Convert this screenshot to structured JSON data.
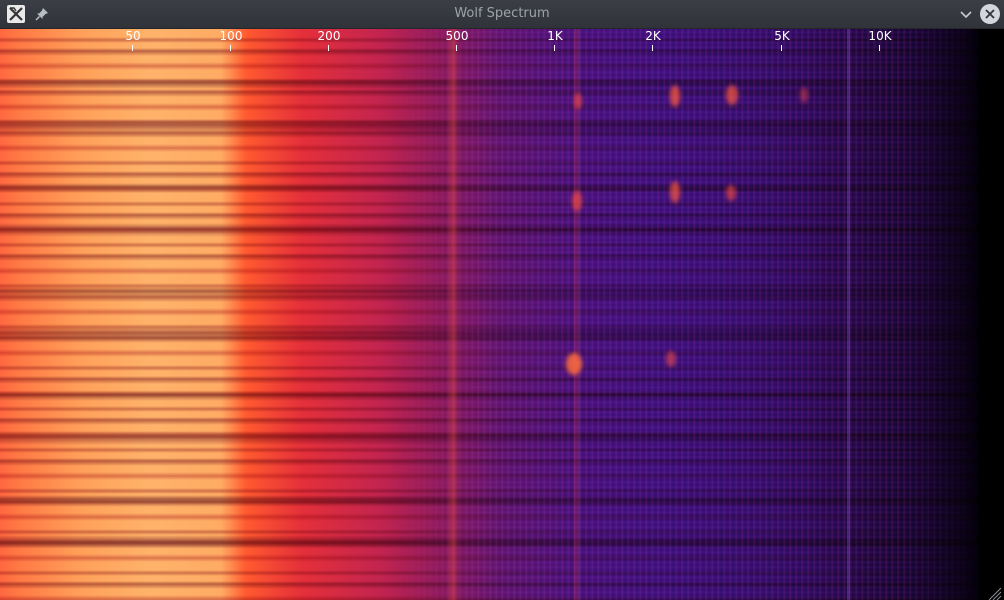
{
  "window": {
    "title": "Wolf Spectrum"
  },
  "icons": {
    "app": "app-logo-icon",
    "pin": "pin-icon",
    "minimize": "chevron-down-icon",
    "close": "close-icon",
    "resize": "resize-grip-icon"
  },
  "spectrum": {
    "frequency_ticks": [
      "50",
      "100",
      "200",
      "500",
      "1K",
      "2K",
      "5K",
      "10K"
    ],
    "colors": {
      "hot": "#ffb36a",
      "warm": "#e5303a",
      "mid": "#5c1470",
      "cold": "#2c0a5e",
      "floor": "#000000"
    }
  }
}
